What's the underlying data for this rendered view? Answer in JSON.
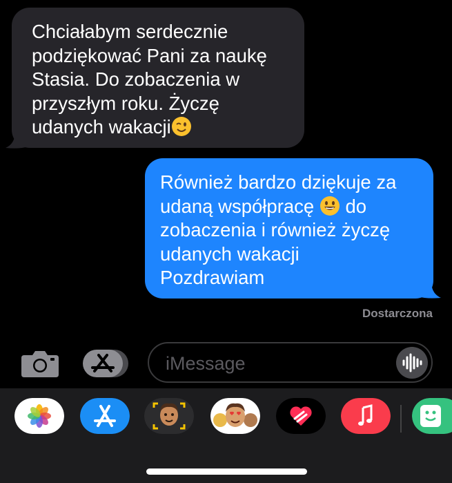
{
  "conversation": {
    "messages": [
      {
        "direction": "incoming",
        "text": "Chciałabym serdecznie\npodziękować Pani za naukę\nStasia. Do zobaczenia w\nprzyszłym roku. Życzę\nudanych wakacji",
        "trailing_emoji": "winking-face-emoji"
      },
      {
        "direction": "outgoing",
        "text_before_emoji": "Również bardzo dziękuje za\nudaną współpracę ",
        "emoji": "grinning-face-emoji",
        "text_after_emoji": " do\nzobaczenia i również życzę\nudanych wakacji\nPozdrawiam"
      }
    ],
    "delivery_status": "Dostarczona"
  },
  "composer": {
    "placeholder": "iMessage",
    "left_buttons": [
      "camera-icon",
      "app-store-icon"
    ],
    "right_button": "audio-waveform-icon"
  },
  "app_drawer": {
    "apps": [
      "photos",
      "app-store",
      "memoji-stickers",
      "memoji",
      "digital-touch",
      "music",
      "giphy"
    ]
  },
  "colors": {
    "background": "#000000",
    "incoming_bubble": "#26252a",
    "outgoing_bubble": "#1e85fe",
    "status_text": "#8e8d93",
    "drawer_background": "#1c1c1e"
  }
}
